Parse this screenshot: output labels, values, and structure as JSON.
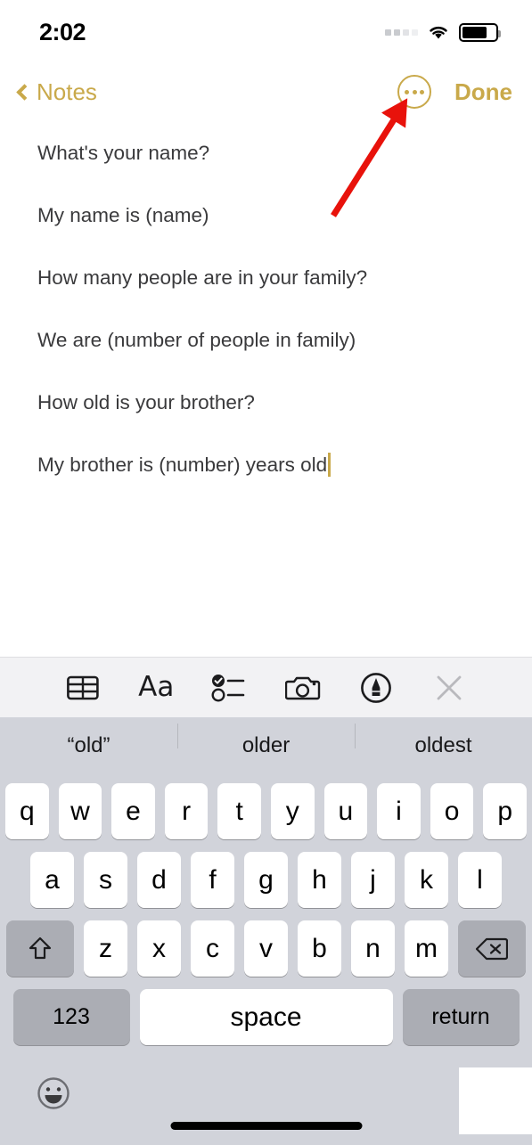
{
  "status_bar": {
    "time": "2:02",
    "signal_icon": "cellular-signal-icon",
    "wifi_icon": "wifi-icon",
    "battery_icon": "battery-icon",
    "battery_level_percent": 74
  },
  "nav_bar": {
    "back_label": "Notes",
    "back_icon": "chevron-left-icon",
    "more_icon": "more-ellipsis-icon",
    "done_label": "Done",
    "accent_color": "#C9A94A"
  },
  "note": {
    "lines": [
      "What's your name?",
      "My name is (name)",
      "How many people are in your family?",
      "We are (number of people in family)",
      "How old is your brother?",
      "My brother is (number) years old"
    ],
    "text_color": "#3A3A3C",
    "caret_color": "#C9A94A"
  },
  "annotation": {
    "arrow_color": "#E8120B",
    "points_to": "more-ellipsis-button"
  },
  "notes_toolbar": {
    "items": [
      {
        "name": "table-icon",
        "label": "Table"
      },
      {
        "name": "format-aa-icon",
        "label": "Aa"
      },
      {
        "name": "checklist-icon",
        "label": "Checklist"
      },
      {
        "name": "camera-icon",
        "label": "Camera"
      },
      {
        "name": "markup-pen-icon",
        "label": "Markup"
      },
      {
        "name": "close-icon",
        "label": "Close"
      }
    ],
    "background": "#F2F2F4"
  },
  "keyboard": {
    "predictions": [
      "“old”",
      "older",
      "oldest"
    ],
    "row1": [
      "q",
      "w",
      "e",
      "r",
      "t",
      "y",
      "u",
      "i",
      "o",
      "p"
    ],
    "row2": [
      "a",
      "s",
      "d",
      "f",
      "g",
      "h",
      "j",
      "k",
      "l"
    ],
    "row3": [
      "z",
      "x",
      "c",
      "v",
      "b",
      "n",
      "m"
    ],
    "shift_icon": "shift-arrow-icon",
    "delete_icon": "backspace-delete-icon",
    "numbers_label": "123",
    "space_label": "space",
    "return_label": "return",
    "emoji_icon": "emoji-smiley-icon",
    "background": "#D1D3DA",
    "key_color": "#FFFFFF",
    "modifier_key_color": "#ABADB4"
  }
}
